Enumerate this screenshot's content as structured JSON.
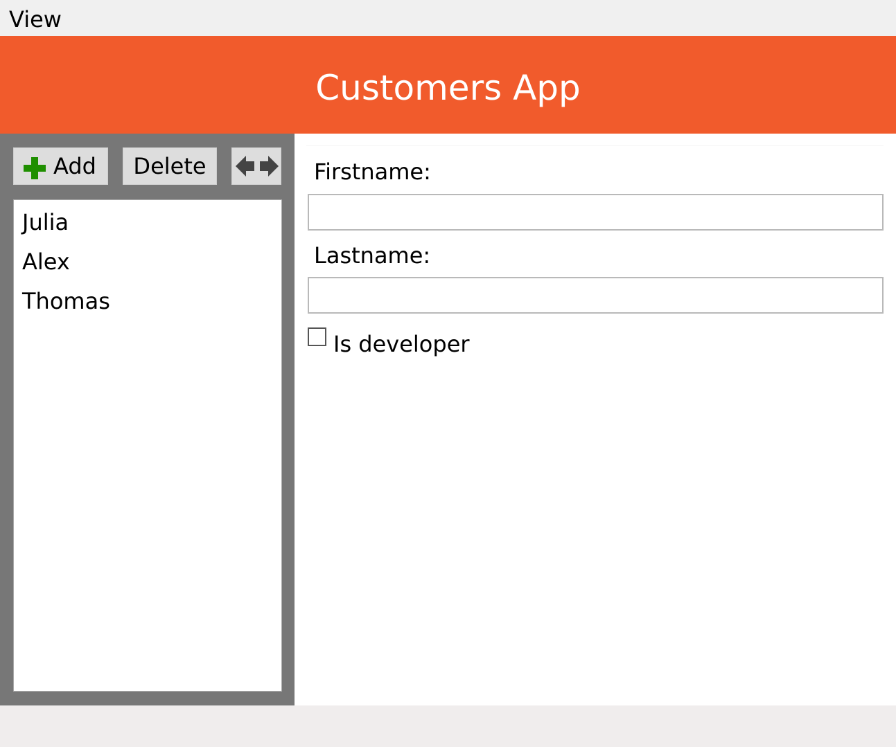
{
  "menu": {
    "items": [
      {
        "label": "View"
      }
    ]
  },
  "header": {
    "title": "Customers App",
    "background": "#f15b2c"
  },
  "toolbar": {
    "add_label": "Add",
    "add_icon": "plus-icon",
    "add_icon_color": "#1f8f00",
    "delete_label": "Delete",
    "swap_icon": "left-right-arrows-icon"
  },
  "customers": {
    "list": [
      "Julia",
      "Alex",
      "Thomas"
    ]
  },
  "form": {
    "firstname_label": "Firstname:",
    "firstname_value": "",
    "lastname_label": "Lastname:",
    "lastname_value": "",
    "developer_label": "Is developer",
    "developer_checked": false
  },
  "colors": {
    "sidebar": "#777777",
    "button": "#dddddd",
    "menubar": "#f0f0f0"
  }
}
